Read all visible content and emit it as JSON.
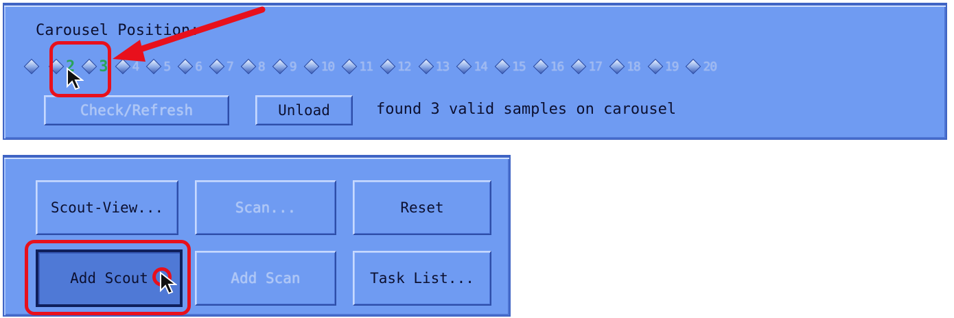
{
  "carousel": {
    "title": "Carousel Position:",
    "positions": [
      {
        "label": ""
      },
      {
        "label": "2",
        "valid": true
      },
      {
        "label": "3",
        "valid": true
      },
      {
        "label": "4"
      },
      {
        "label": "5"
      },
      {
        "label": "6"
      },
      {
        "label": "7"
      },
      {
        "label": "8"
      },
      {
        "label": "9"
      },
      {
        "label": "10"
      },
      {
        "label": "11"
      },
      {
        "label": "12"
      },
      {
        "label": "13"
      },
      {
        "label": "14"
      },
      {
        "label": "15"
      },
      {
        "label": "16"
      },
      {
        "label": "17"
      },
      {
        "label": "18"
      },
      {
        "label": "19"
      },
      {
        "label": "20"
      }
    ],
    "check_refresh_label": "Check/Refresh",
    "unload_label": "Unload",
    "status_text": "found 3 valid samples on carousel"
  },
  "tasks": {
    "scout_view_label": "Scout-View...",
    "scan_label": "Scan...",
    "reset_label": "Reset",
    "add_scout_label": "Add Scout",
    "add_scan_label": "Add Scan",
    "task_list_label": "Task List..."
  },
  "annotations": {
    "highlight_color": "#e8101c"
  }
}
